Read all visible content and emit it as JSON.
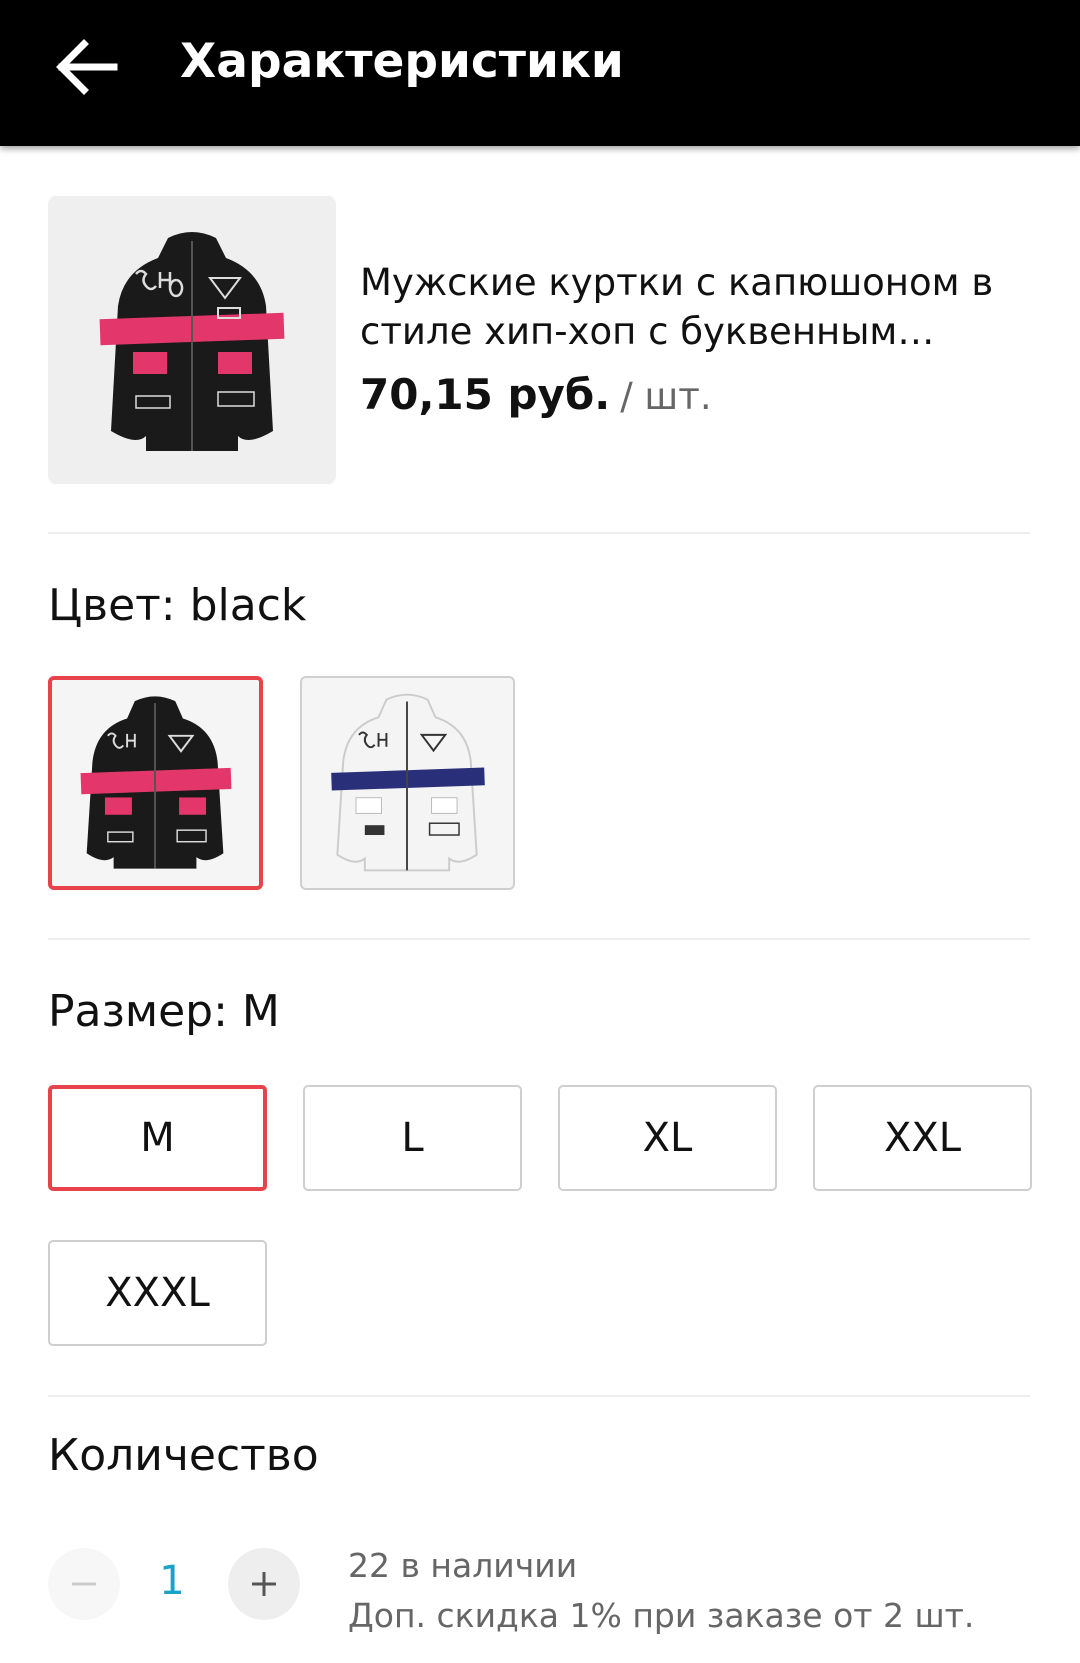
{
  "header": {
    "title": "Характеристики",
    "back_icon": "arrow-left-icon"
  },
  "product": {
    "title": "Мужские куртки с капюшоном в стиле хип-хоп с буквенным принтом",
    "price": "70,15 руб.",
    "unit": "/ шт."
  },
  "color": {
    "label": "Цвет: black",
    "options": [
      {
        "name": "black",
        "selected": true,
        "body": "#1a1a1a",
        "stripe": "#e3366b"
      },
      {
        "name": "white",
        "selected": false,
        "body": "#f2f2f2",
        "stripe": "#2a2f7a"
      }
    ],
    "accent": "#e8434a"
  },
  "size": {
    "label": "Размер: M",
    "options": [
      "M",
      "L",
      "XL",
      "XXL",
      "XXXL"
    ],
    "selected": "M"
  },
  "quantity": {
    "label": "Количество",
    "value": "1",
    "minus_icon": "minus-icon",
    "plus_icon": "plus-icon",
    "stock": "22 в наличии",
    "discount": "Доп. скидка 1% при заказе от 2 шт."
  }
}
